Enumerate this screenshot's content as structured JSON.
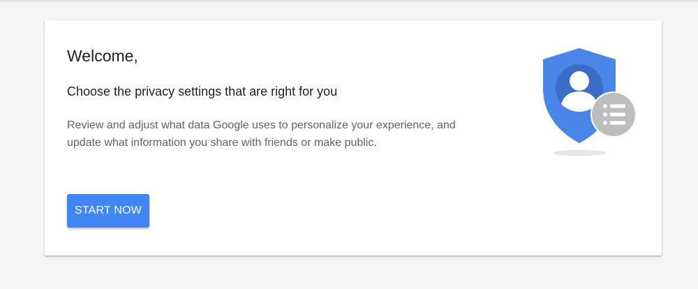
{
  "card": {
    "greeting": "Welcome,",
    "heading": "Choose the privacy settings that are right for you",
    "description": "Review and adjust what data Google uses to personalize your experience, and update what information you share with friends or make public.",
    "start_button_label": "START NOW"
  },
  "illustration": {
    "icons": [
      "shield-icon",
      "account-icon",
      "list-icon"
    ]
  },
  "colors": {
    "accent": "#4285f4",
    "shield": "#4a86e8",
    "shield_inner": "#3b6cc8",
    "badge": "#bdbdbd",
    "background": "#f5f5f5"
  }
}
